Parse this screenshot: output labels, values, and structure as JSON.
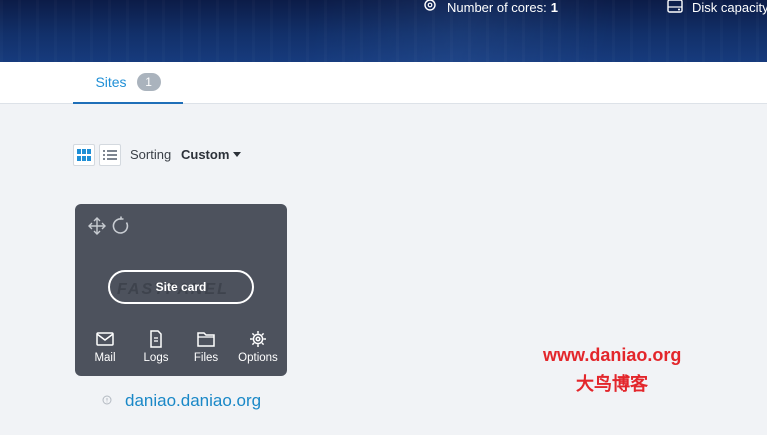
{
  "banner": {
    "cores_label": "Number of cores:",
    "cores_value": "1",
    "disk_label": "Disk capacity"
  },
  "tabs": [
    {
      "label": "Sites",
      "count": "1"
    }
  ],
  "toolbar": {
    "sorting_label": "Sorting",
    "sorting_value": "Custom"
  },
  "site_card": {
    "logo_text": "FASTPANEL",
    "open_label": "Site card",
    "actions": [
      {
        "label": "Mail",
        "icon": "envelope-icon"
      },
      {
        "label": "Logs",
        "icon": "document-icon"
      },
      {
        "label": "Files",
        "icon": "folder-icon"
      },
      {
        "label": "Options",
        "icon": "gear-icon"
      }
    ],
    "domain": "daniao.daniao.org"
  },
  "watermark": {
    "url": "www.daniao.org",
    "text": "大鸟博客"
  },
  "colors": {
    "accent": "#1f8fd6",
    "banner": "#12306a",
    "card_bg": "#4d525d",
    "watermark": "#e3262b"
  }
}
